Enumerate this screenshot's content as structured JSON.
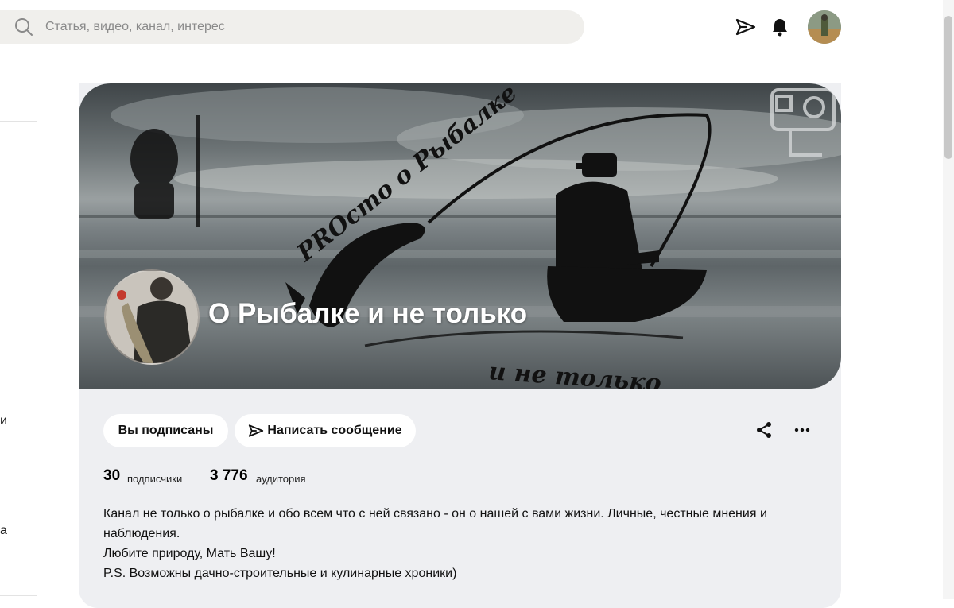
{
  "search": {
    "placeholder": "Статья, видео, канал, интерес"
  },
  "header": {
    "icons": [
      "send-icon",
      "bell-icon"
    ]
  },
  "sidebar": {
    "fragments": [
      "и",
      "а"
    ]
  },
  "channel": {
    "title": "О Рыбалке и не только",
    "cover_texts": [
      "PROсто о Рыбалке",
      "и не только"
    ],
    "subscribe_label": "Вы подписаны",
    "message_label": "Написать сообщение",
    "stats": [
      {
        "value": "30",
        "label": "подписчики"
      },
      {
        "value": "3 776",
        "label": "аудитория"
      }
    ],
    "description": [
      "Канал не только о рыбалке и обо всем что с ней связано - он о нашей с вами жизни. Личные, честные мнения и наблюдения.",
      "Любите природу, Мать Вашу!",
      "P.S. Возможны дачно-строительные и кулинарные хроники)"
    ]
  },
  "colors": {
    "card_bg": "#eeeff2",
    "search_bg": "#f0efec",
    "pill_bg": "#ffffff"
  }
}
